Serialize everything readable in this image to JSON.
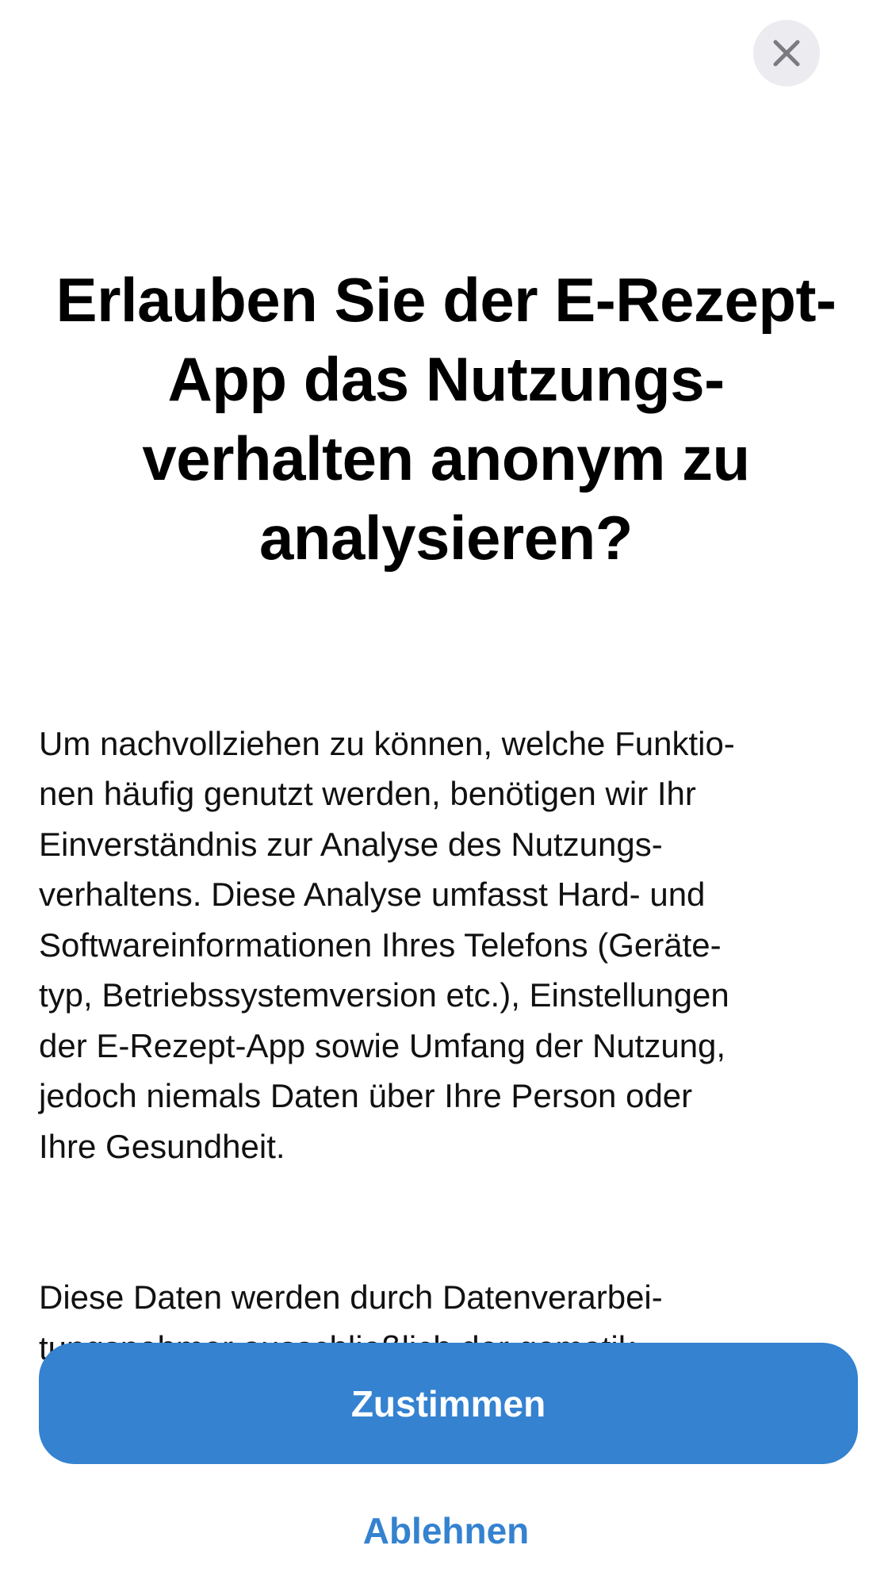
{
  "header": {
    "close_icon": "close-icon"
  },
  "title": "Erlauben Sie der E-Rezept-\nApp das Nutzungs-\nverhalten anonym zu\nanalysieren?",
  "body": {
    "paragraph_1": "Um nachvollziehen zu können, welche Funktio-\nnen häufig genutzt werden, benötigen wir Ihr\nEinverständnis zur Analyse des Nutzungs-\nverhaltens. Diese Analyse umfasst Hard- und\nSoftwareinformationen Ihres Telefons (Geräte-\ntyp, Betriebssystemversion etc.), Einstellungen\nder E-Rezept-App sowie Umfang der Nutzung,\njedoch niemals Daten über Ihre Person oder\nIhre Gesundheit.",
    "paragraph_2": "Diese Daten werden durch Datenverarbei-\ntungsnehmer ausschließlich der gematik"
  },
  "actions": {
    "accept_label": "Zustimmen",
    "decline_label": "Ablehnen"
  },
  "colors": {
    "accent": "#3482d0",
    "close_button_bg": "#ececf0",
    "close_icon": "#7a7a80"
  }
}
